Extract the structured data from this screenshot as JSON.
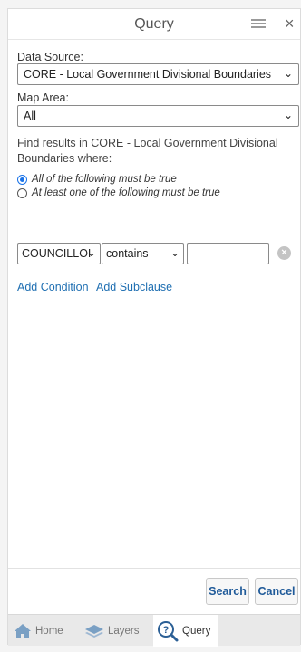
{
  "header": {
    "title": "Query"
  },
  "form": {
    "data_source_label": "Data Source:",
    "data_source_value": "CORE - Local Government Divisional Boundaries",
    "map_area_label": "Map Area:",
    "map_area_value": "All",
    "find_text": "Find results in CORE - Local Government Divisional Boundaries where:",
    "radio_all": "All of the following must be true",
    "radio_any": "At least one of the following must be true",
    "condition": {
      "field": "COUNCILLOI",
      "operator": "contains",
      "value": ""
    },
    "add_condition": "Add Condition",
    "add_subclause": "Add Subclause"
  },
  "footer": {
    "search_label": "Search",
    "cancel_label": "Cancel"
  },
  "tabs": [
    {
      "label": "Home",
      "icon": "home-icon"
    },
    {
      "label": "Layers",
      "icon": "layers-icon"
    },
    {
      "label": "Query",
      "icon": "query-icon"
    }
  ],
  "colors": {
    "link": "#1f6fb2",
    "accent": "#1a73e8",
    "button_text": "#1f5a99"
  }
}
